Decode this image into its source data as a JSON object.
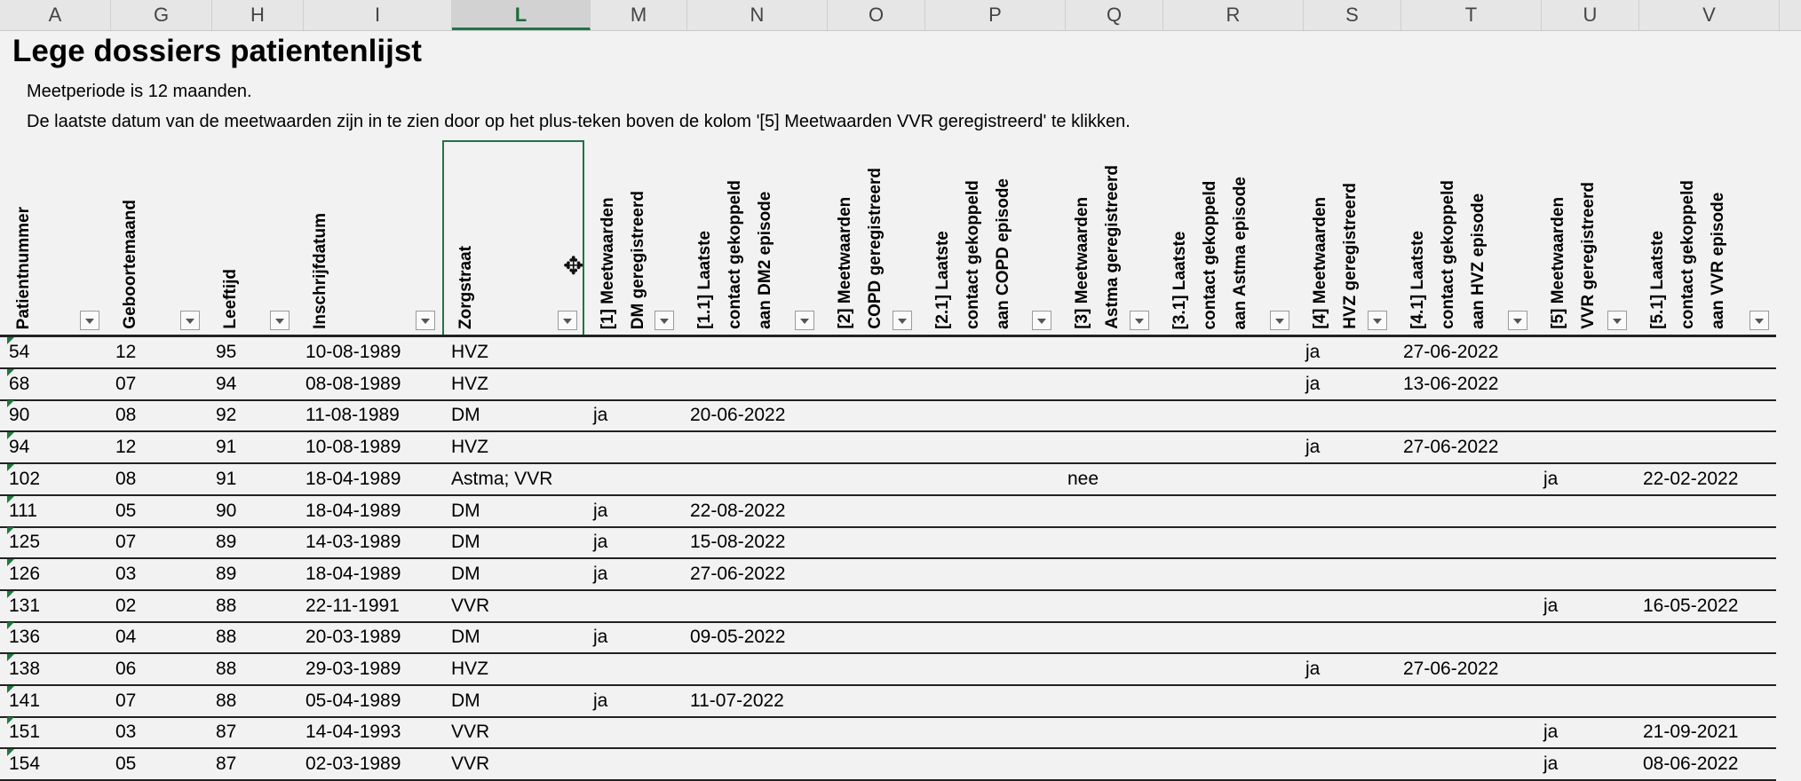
{
  "columns": [
    "A",
    "G",
    "H",
    "I",
    "L",
    "M",
    "N",
    "O",
    "P",
    "Q",
    "R",
    "S",
    "T",
    "U",
    "V"
  ],
  "title": "Lege dossiers patientenlijst",
  "subtitle_1": "Meetperiode is 12 maanden.",
  "subtitle_2": "De laatste datum van de meetwaarden zijn in te zien door op het plus-teken boven de kolom '[5] Meetwaarden VVR geregistreerd' te klikken.",
  "headers": [
    "Patientnummer",
    "Geboortemaand",
    "Leeftijd",
    "Inschrijfdatum",
    "Zorgstraat",
    "[1] Meetwaarden\nDM geregistreerd",
    "[1.1] Laatste\ncontact gekoppeld\naan DM2 episode",
    "[2] Meetwaarden\nCOPD geregistreerd",
    "[2.1] Laatste\ncontact gekoppeld\naan COPD episode",
    "[3] Meetwaarden\nAstma geregistreerd",
    "[3.1] Laatste\ncontact gekoppeld\naan Astma episode",
    "[4] Meetwaarden\nHVZ geregistreerd",
    "[4.1] Laatste\ncontact gekoppeld\naan HVZ episode",
    "[5] Meetwaarden\nVVR geregistreerd",
    "[5.1] Laatste\ncontact gekoppeld\naan VVR episode"
  ],
  "rows": [
    [
      "54",
      "12",
      "95",
      "10-08-1989",
      "HVZ",
      "",
      "",
      "",
      "",
      "",
      "",
      "ja",
      "27-06-2022",
      "",
      ""
    ],
    [
      "68",
      "07",
      "94",
      "08-08-1989",
      "HVZ",
      "",
      "",
      "",
      "",
      "",
      "",
      "ja",
      "13-06-2022",
      "",
      ""
    ],
    [
      "90",
      "08",
      "92",
      "11-08-1989",
      "DM",
      "ja",
      "20-06-2022",
      "",
      "",
      "",
      "",
      "",
      "",
      "",
      ""
    ],
    [
      "94",
      "12",
      "91",
      "10-08-1989",
      "HVZ",
      "",
      "",
      "",
      "",
      "",
      "",
      "ja",
      "27-06-2022",
      "",
      ""
    ],
    [
      "102",
      "08",
      "91",
      "18-04-1989",
      "Astma; VVR",
      "",
      "",
      "",
      "",
      "nee",
      "",
      "",
      "",
      "ja",
      "22-02-2022"
    ],
    [
      "111",
      "05",
      "90",
      "18-04-1989",
      "DM",
      "ja",
      "22-08-2022",
      "",
      "",
      "",
      "",
      "",
      "",
      "",
      ""
    ],
    [
      "125",
      "07",
      "89",
      "14-03-1989",
      "DM",
      "ja",
      "15-08-2022",
      "",
      "",
      "",
      "",
      "",
      "",
      "",
      ""
    ],
    [
      "126",
      "03",
      "89",
      "18-04-1989",
      "DM",
      "ja",
      "27-06-2022",
      "",
      "",
      "",
      "",
      "",
      "",
      "",
      ""
    ],
    [
      "131",
      "02",
      "88",
      "22-11-1991",
      "VVR",
      "",
      "",
      "",
      "",
      "",
      "",
      "",
      "",
      "ja",
      "16-05-2022"
    ],
    [
      "136",
      "04",
      "88",
      "20-03-1989",
      "DM",
      "ja",
      "09-05-2022",
      "",
      "",
      "",
      "",
      "",
      "",
      "",
      ""
    ],
    [
      "138",
      "06",
      "88",
      "29-03-1989",
      "HVZ",
      "",
      "",
      "",
      "",
      "",
      "",
      "ja",
      "27-06-2022",
      "",
      ""
    ],
    [
      "141",
      "07",
      "88",
      "05-04-1989",
      "DM",
      "ja",
      "11-07-2022",
      "",
      "",
      "",
      "",
      "",
      "",
      "",
      ""
    ],
    [
      "151",
      "03",
      "87",
      "14-04-1993",
      "VVR",
      "",
      "",
      "",
      "",
      "",
      "",
      "",
      "",
      "ja",
      "21-09-2021"
    ],
    [
      "154",
      "05",
      "87",
      "02-03-1989",
      "VVR",
      "",
      "",
      "",
      "",
      "",
      "",
      "",
      "",
      "ja",
      "08-06-2022"
    ]
  ]
}
